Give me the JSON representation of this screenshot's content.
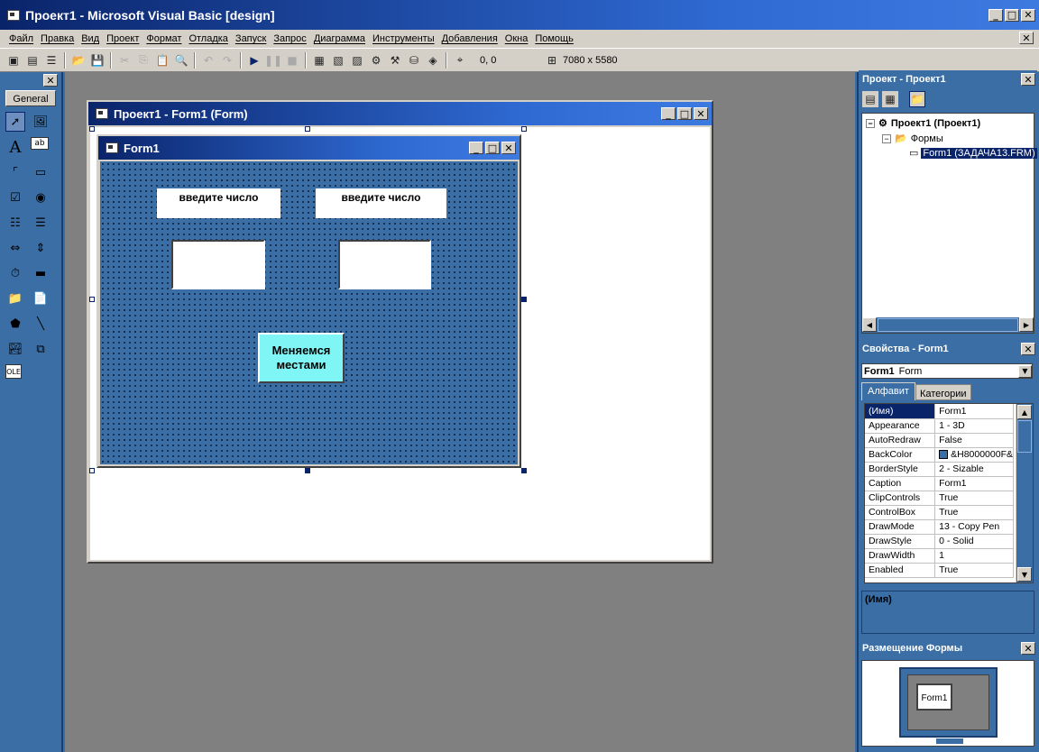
{
  "window": {
    "title": "Проект1 - Microsoft Visual Basic [design]"
  },
  "menu": [
    "Файл",
    "Правка",
    "Вид",
    "Проект",
    "Формат",
    "Отладка",
    "Запуск",
    "Запрос",
    "Диаграмма",
    "Инструменты",
    "Добавления",
    "Окна",
    "Помощь"
  ],
  "toolbar": {
    "position": "0, 0",
    "size": "7080 x 5580"
  },
  "toolbox": {
    "tab": "General"
  },
  "form_designer": {
    "title": "Проект1 - Form1 (Form)",
    "form_title": "Form1",
    "label1": "введите число",
    "label2": "введите число",
    "text1": "",
    "text2": "",
    "button_line1": "Меняемся",
    "button_line2": "местами"
  },
  "project": {
    "title": "Проект - Проект1",
    "root": "Проект1 (Проект1)",
    "folder": "Формы",
    "item": "Form1 (ЗАДАЧА13.FRM)"
  },
  "properties": {
    "title": "Свойства - Form1",
    "object_name": "Form1",
    "object_type": "Form",
    "tabs": [
      "Алфавит",
      "Категории"
    ],
    "rows": [
      {
        "name": "(Имя)",
        "value": "Form1"
      },
      {
        "name": "Appearance",
        "value": "1 - 3D"
      },
      {
        "name": "AutoRedraw",
        "value": "False"
      },
      {
        "name": "BackColor",
        "value": "&H8000000F&"
      },
      {
        "name": "BorderStyle",
        "value": "2 - Sizable"
      },
      {
        "name": "Caption",
        "value": "Form1"
      },
      {
        "name": "ClipControls",
        "value": "True"
      },
      {
        "name": "ControlBox",
        "value": "True"
      },
      {
        "name": "DrawMode",
        "value": "13 - Copy Pen"
      },
      {
        "name": "DrawStyle",
        "value": "0 - Solid"
      },
      {
        "name": "DrawWidth",
        "value": "1"
      },
      {
        "name": "Enabled",
        "value": "True"
      }
    ],
    "description_title": "(Имя)"
  },
  "layout_window": {
    "title": "Размещение Формы",
    "form_label": "Form1"
  },
  "colors": {
    "accent": "#0a246a",
    "panel_bg": "#3a6ea5",
    "button_bg": "#7ff5f5"
  }
}
